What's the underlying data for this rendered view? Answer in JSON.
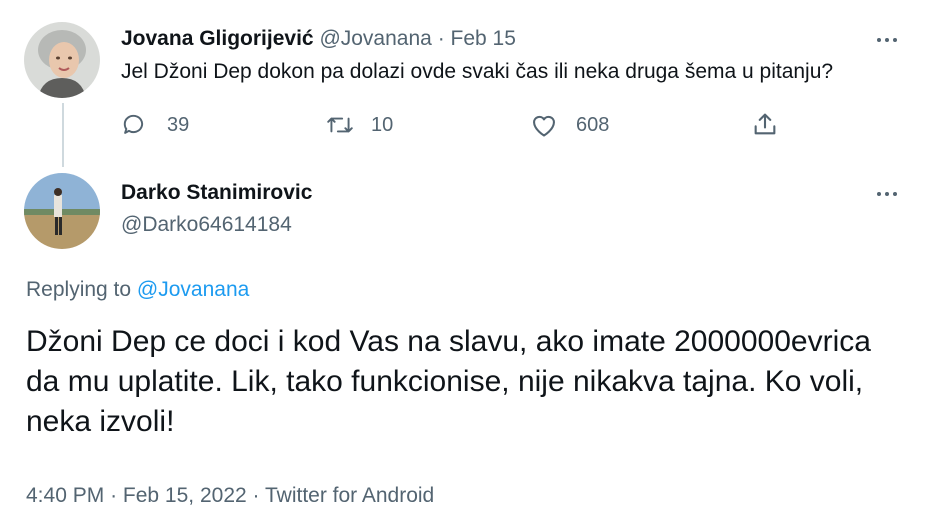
{
  "parent_tweet": {
    "author_name": "Jovana Gligorijević",
    "handle": "@Jovanana",
    "separator": "·",
    "date": "Feb 15",
    "text": "Jel Džoni Dep dokon pa dolazi ovde svaki čas ili neka druga šema u pitanju?",
    "actions": {
      "reply_icon": "reply-icon",
      "reply_count": "39",
      "retweet_icon": "retweet-icon",
      "retweet_count": "10",
      "like_icon": "heart-icon",
      "like_count": "608",
      "share_icon": "share-icon"
    }
  },
  "main_tweet": {
    "author_name": "Darko Stanimirovic",
    "handle": "@Darko64614184",
    "replying_prefix": "Replying to",
    "replying_to": "@Jovanana",
    "text": "Džoni Dep ce doci i kod Vas na slavu, ako imate 2000000evrica da mu uplatite. Lik, tako funkcionise, nije nikakva tajna. Ko voli, neka izvoli!",
    "time": "4:40 PM",
    "date": "Feb 15, 2022",
    "source": "Twitter for Android",
    "separator": "·"
  },
  "colors": {
    "text": "#0f1419",
    "muted": "#536471",
    "link": "#1d9bf0",
    "thread_line": "#cfd9de"
  }
}
